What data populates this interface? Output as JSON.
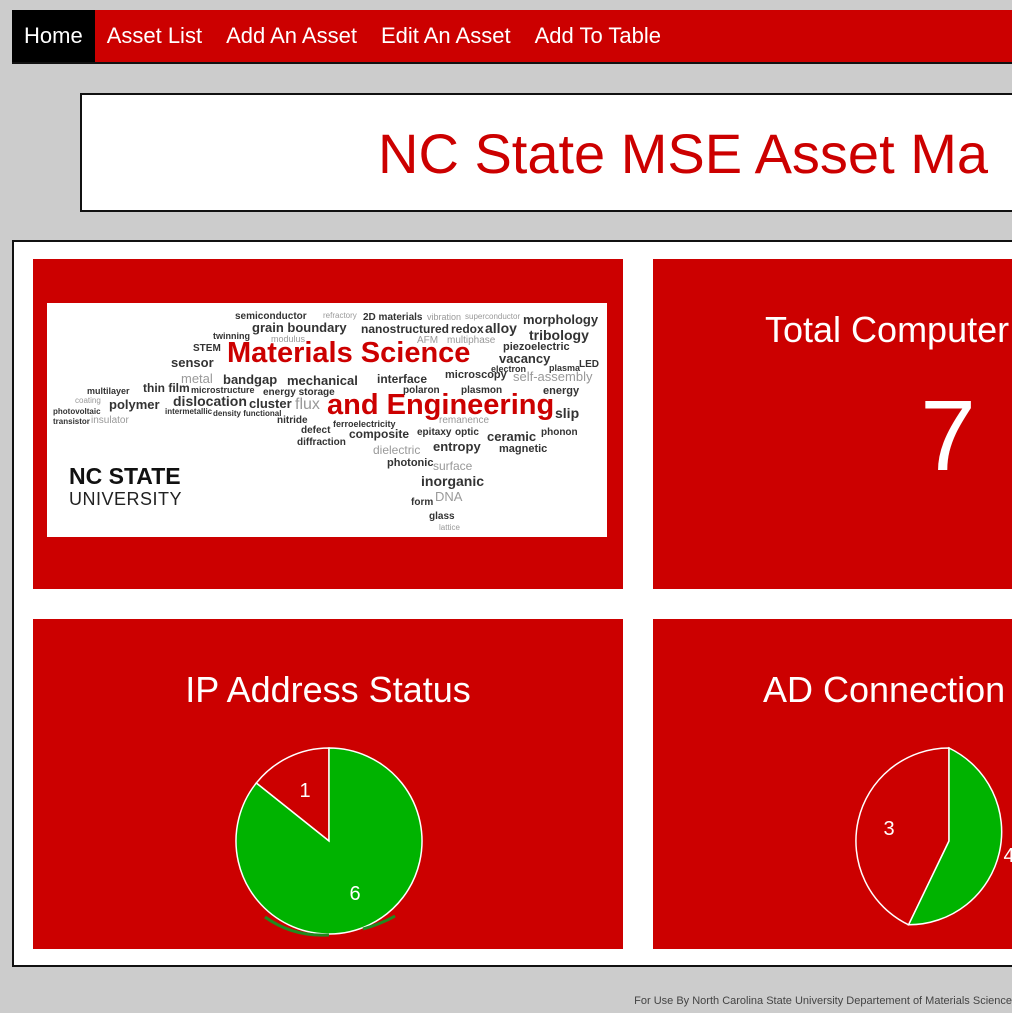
{
  "nav": {
    "items": [
      {
        "label": "Home",
        "active": true
      },
      {
        "label": "Asset List",
        "active": false
      },
      {
        "label": "Add An Asset",
        "active": false
      },
      {
        "label": "Edit An Asset",
        "active": false
      },
      {
        "label": "Add To Table",
        "active": false
      }
    ]
  },
  "header": {
    "title": "NC State MSE Asset Ma"
  },
  "logo": {
    "word_cloud_title_1": "Materials Science",
    "word_cloud_title_2": "and Engineering",
    "university_name": "NC STATE",
    "university_sub": "UNIVERSITY",
    "words": [
      "semiconductor",
      "refractory",
      "2D materials",
      "vibration",
      "superconductor",
      "morphology",
      "twinning",
      "grain boundary",
      "nanostructured",
      "redox",
      "alloy",
      "tribology",
      "STEM",
      "modulus",
      "AFM",
      "multiphase",
      "piezoelectric",
      "sensor",
      "vacancy",
      "electron",
      "plasma",
      "LED",
      "metal",
      "bandgap",
      "mechanical",
      "interface",
      "microscopy",
      "self-assembly",
      "multilayer",
      "thin film",
      "microstructure",
      "energy storage",
      "polaron",
      "plasmon",
      "energy",
      "coating",
      "polymer",
      "dislocation",
      "cluster",
      "flux",
      "slip",
      "photovoltaic",
      "intermetallic",
      "density functional",
      "transistor",
      "insulator",
      "nitride",
      "ferroelectricity",
      "remanence",
      "defect",
      "composite",
      "epitaxy",
      "optic",
      "ceramic",
      "phonon",
      "diffraction",
      "dielectric",
      "entropy",
      "magnetic",
      "photonic",
      "surface",
      "inorganic",
      "DNA",
      "form",
      "glass",
      "lattice"
    ]
  },
  "tiles": {
    "total_computers": {
      "title": "Total Computer",
      "value": "7"
    },
    "ip_status": {
      "title": "IP Address Status",
      "slice_labels": [
        "1",
        "6"
      ]
    },
    "ad_connection": {
      "title": "AD Connection",
      "slice_labels": [
        "3",
        "4"
      ]
    }
  },
  "colors": {
    "brand_red": "#cc0000",
    "pie_green": "#00b300",
    "pie_red": "#cc0000"
  },
  "chart_data": [
    {
      "type": "pie",
      "title": "IP Address Status",
      "categories": [
        "",
        ""
      ],
      "values": [
        1,
        6
      ],
      "colors": [
        "#cc0000",
        "#00b300"
      ]
    },
    {
      "type": "pie",
      "title": "AD Connection",
      "categories": [
        "",
        ""
      ],
      "values": [
        3,
        4
      ],
      "colors": [
        "#cc0000",
        "#00b300"
      ]
    }
  ],
  "footer": {
    "text": "For Use By North Carolina State University Departement of Materials Science"
  }
}
